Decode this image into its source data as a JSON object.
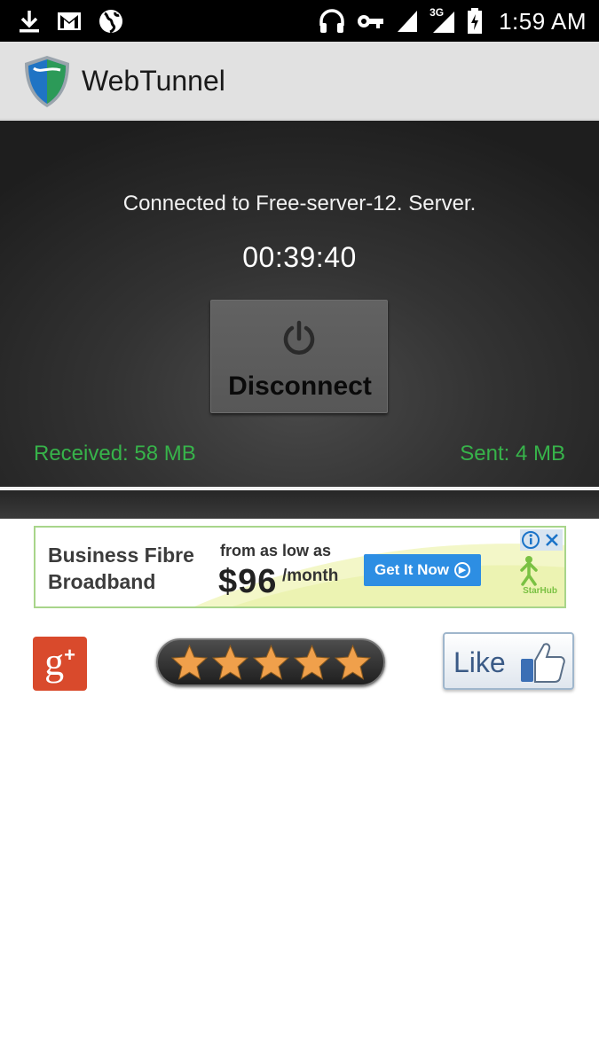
{
  "status_bar": {
    "time": "1:59 AM",
    "network_label": "3G",
    "left_icons": [
      "download-icon",
      "gmail-icon",
      "globe-icon"
    ],
    "right_icons": [
      "headset-icon",
      "vpn-key-icon",
      "signal-icon",
      "signal-3g-icon",
      "battery-charging-icon"
    ]
  },
  "app": {
    "title": "WebTunnel",
    "logo_icon": "shield-logo-icon"
  },
  "connection": {
    "status_text": "Connected to Free-server-12. Server.",
    "elapsed_time": "00:39:40",
    "disconnect_label": "Disconnect",
    "received": "Received: 58 MB",
    "sent": "Sent: 4 MB"
  },
  "ad": {
    "title": "Business Fibre Broadband",
    "price_prefix": "from as low as",
    "price": "$96",
    "price_suffix": "/month",
    "cta": "Get It Now",
    "brand": "StarHub"
  },
  "social": {
    "gplus_label": "g",
    "gplus_plus": "+",
    "rating_stars": 5,
    "like_label": "Like"
  },
  "colors": {
    "status_green": "#37b34a",
    "gplus_red": "#d94a2c",
    "star_orange": "#f0a04b",
    "cta_blue": "#2d8ee3"
  }
}
